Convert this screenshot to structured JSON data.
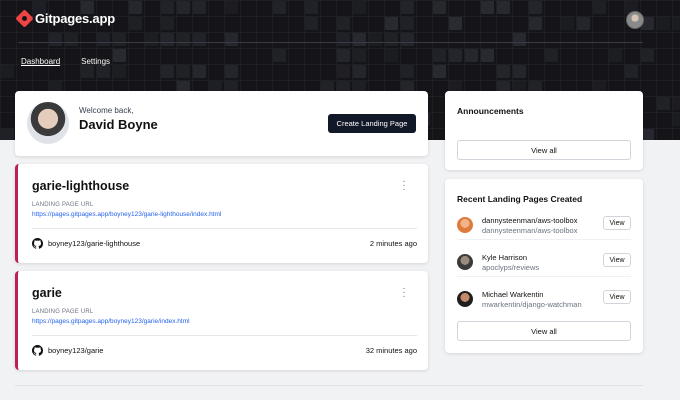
{
  "app": {
    "name": "Gitpages.app"
  },
  "nav": {
    "items": [
      {
        "label": "Dashboard"
      },
      {
        "label": "Settings"
      }
    ]
  },
  "welcome": {
    "subtitle": "Welcome back,",
    "name": "David Boyne",
    "create_button": "Create Landing Page"
  },
  "pages": [
    {
      "title": "garie-lighthouse",
      "url_label": "LANDING PAGE URL",
      "url": "https://pages.gitpages.app/boyney123/garie-lighthouse/index.html",
      "repo": "boyney123/garie-lighthouse",
      "time": "2 minutes ago"
    },
    {
      "title": "garie",
      "url_label": "LANDING PAGE URL",
      "url": "https://pages.gitpages.app/boyney123/garie/index.html",
      "repo": "boyney123/garie",
      "time": "32 minutes ago"
    }
  ],
  "announcements": {
    "title": "Announcements",
    "view_all": "View all"
  },
  "recent": {
    "title": "Recent Landing Pages Created",
    "items": [
      {
        "name": "dannysteenman/aws-toolbox",
        "repo": "dannysteenman/aws-toolbox",
        "view": "View"
      },
      {
        "name": "Kyle Harrison",
        "repo": "apoclyps/reviews",
        "view": "View"
      },
      {
        "name": "Michael Warkentin",
        "repo": "mwarkentin/django-watchman",
        "view": "View"
      }
    ],
    "view_all": "View all"
  },
  "colors": {
    "accent": "#be2150",
    "brand": "#ef4444",
    "link": "#2563eb",
    "header_bg": "#141419"
  },
  "icons": {
    "logo": "gitpages-logo-icon",
    "repo": "github-icon",
    "menu": "kebab-menu-icon"
  }
}
